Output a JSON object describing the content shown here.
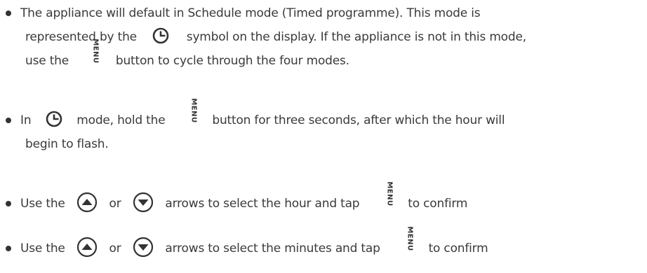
{
  "items": [
    {
      "lines": [
        {
          "a": "The appliance will default in Schedule mode (Timed programme). This mode is"
        },
        {
          "a": "represented by the",
          "b": "symbol on the display. If the appliance is not in this mode,"
        },
        {
          "a": "use the",
          "b": "button to cycle through the four modes."
        }
      ]
    },
    {
      "lines": [
        {
          "a": "In",
          "b": "mode, hold the",
          "c": "button for three seconds, after which the hour will"
        },
        {
          "a": "begin to flash."
        }
      ]
    },
    {
      "lines": [
        {
          "a": "Use the",
          "b": "or",
          "c": "arrows to select the hour and tap",
          "d": "to confirm"
        }
      ]
    },
    {
      "lines": [
        {
          "a": "Use the",
          "b": "or",
          "c": "arrows to select the minutes and tap",
          "d": "to confirm"
        }
      ]
    }
  ],
  "icons": {
    "menu_label": "MENU",
    "clock": "clock-schedule-icon",
    "up": "up-arrow-icon",
    "down": "down-arrow-icon"
  }
}
